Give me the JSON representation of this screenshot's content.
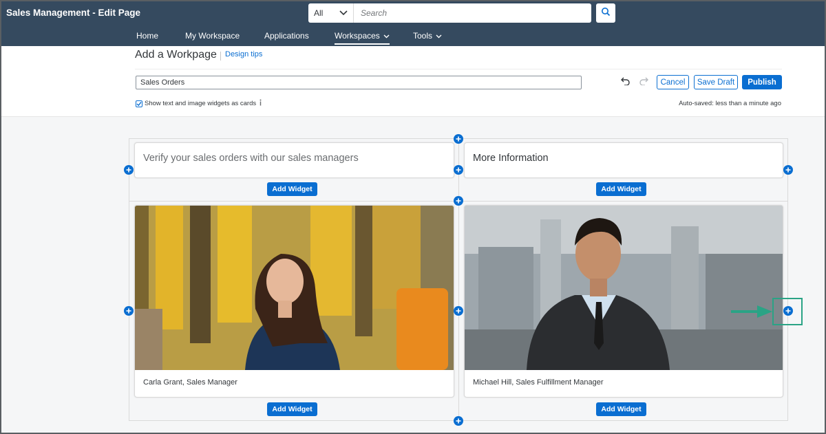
{
  "app": {
    "title": "Sales Management - Edit Page"
  },
  "search": {
    "scope": "All",
    "placeholder": "Search"
  },
  "nav": {
    "items": [
      {
        "label": "Home"
      },
      {
        "label": "My Workspace"
      },
      {
        "label": "Applications"
      },
      {
        "label": "Workspaces"
      },
      {
        "label": "Tools"
      }
    ]
  },
  "header": {
    "title": "Add a Workpage",
    "design_tips": "Design tips",
    "page_name": "Sales Orders",
    "cancel": "Cancel",
    "save_draft": "Save Draft",
    "publish": "Publish",
    "cards_toggle": "Show text and image widgets as cards",
    "cards_toggle_checked": true,
    "autosaved": "Auto-saved: less than a minute ago"
  },
  "widgets": {
    "text_left": "Verify your sales orders with our sales managers",
    "text_right": "More Information",
    "image_left_caption": "Carla Grant, Sales Manager",
    "image_right_caption": "Michael Hill, Sales Fulfillment Manager",
    "add_widget": "Add Widget"
  },
  "colors": {
    "shell": "#354a5f",
    "accent": "#0a6ed1",
    "callout": "#2aa385"
  }
}
